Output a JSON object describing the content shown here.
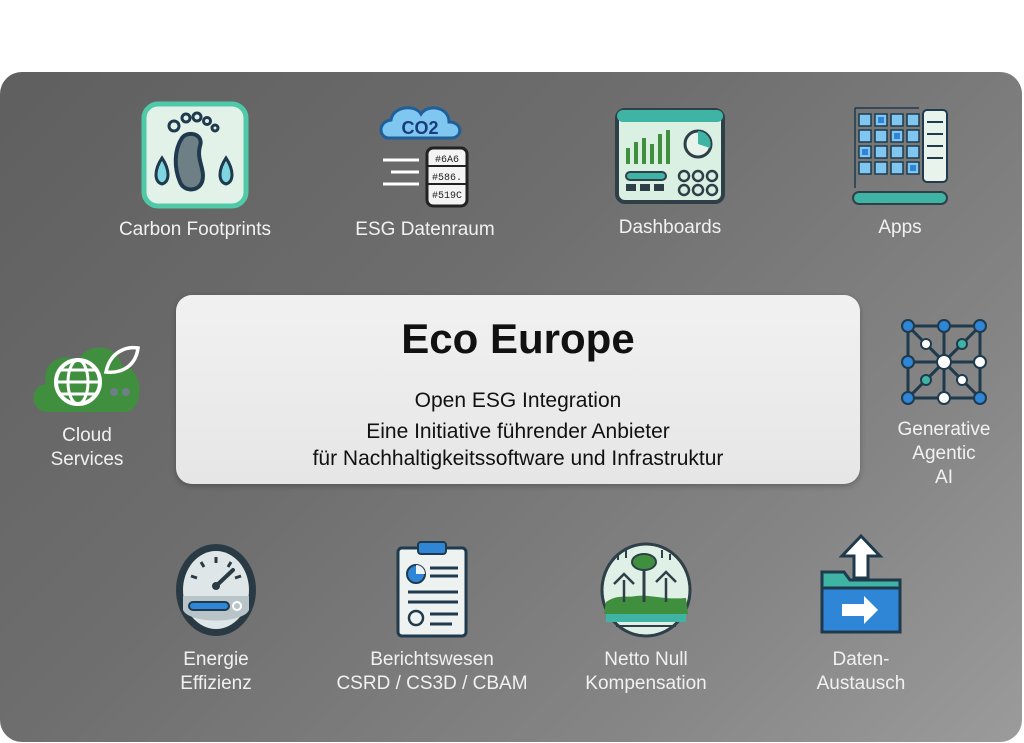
{
  "title": "Eco Europe",
  "subtitle": "Open ESG Integration",
  "description": "Eine Initiative führender Anbieter\nfür Nachhaltigkeitssoftware und Infrastruktur",
  "tiles": {
    "carbon_footprints": {
      "label": "Carbon Footprints",
      "icon": "footprint-icon"
    },
    "esg_datenraum": {
      "label": "ESG Datenraum",
      "icon": "co2-database-icon",
      "icon_text": {
        "cloud": "CO2",
        "rows": [
          "#6A6",
          "#586.",
          "#519C"
        ]
      }
    },
    "dashboards": {
      "label": "Dashboards",
      "icon": "dashboard-icon"
    },
    "apps": {
      "label": "Apps",
      "icon": "apps-icon"
    },
    "cloud_services": {
      "label": "Cloud\nServices",
      "icon": "cloud-globe-icon"
    },
    "generative_ai": {
      "label": "Generative\nAgentic\nAI",
      "icon": "network-icon"
    },
    "energie_effizienz": {
      "label": "Energie\nEffizienz",
      "icon": "gauge-icon"
    },
    "berichtswesen": {
      "label": "Berichtswesen\nCSRD / CS3D / CBAM",
      "icon": "report-icon"
    },
    "netto_null": {
      "label": "Netto Null\nKompensation",
      "icon": "forest-icon"
    },
    "daten_austausch": {
      "label": "Daten-\nAustausch",
      "icon": "folder-upload-icon"
    }
  },
  "colors": {
    "panel": "#6e6e6e",
    "teal": "#3fb3a4",
    "mint": "#dff1e6",
    "navy": "#1f3a4d",
    "blue": "#2f86d6",
    "green": "#3f8f3f"
  }
}
